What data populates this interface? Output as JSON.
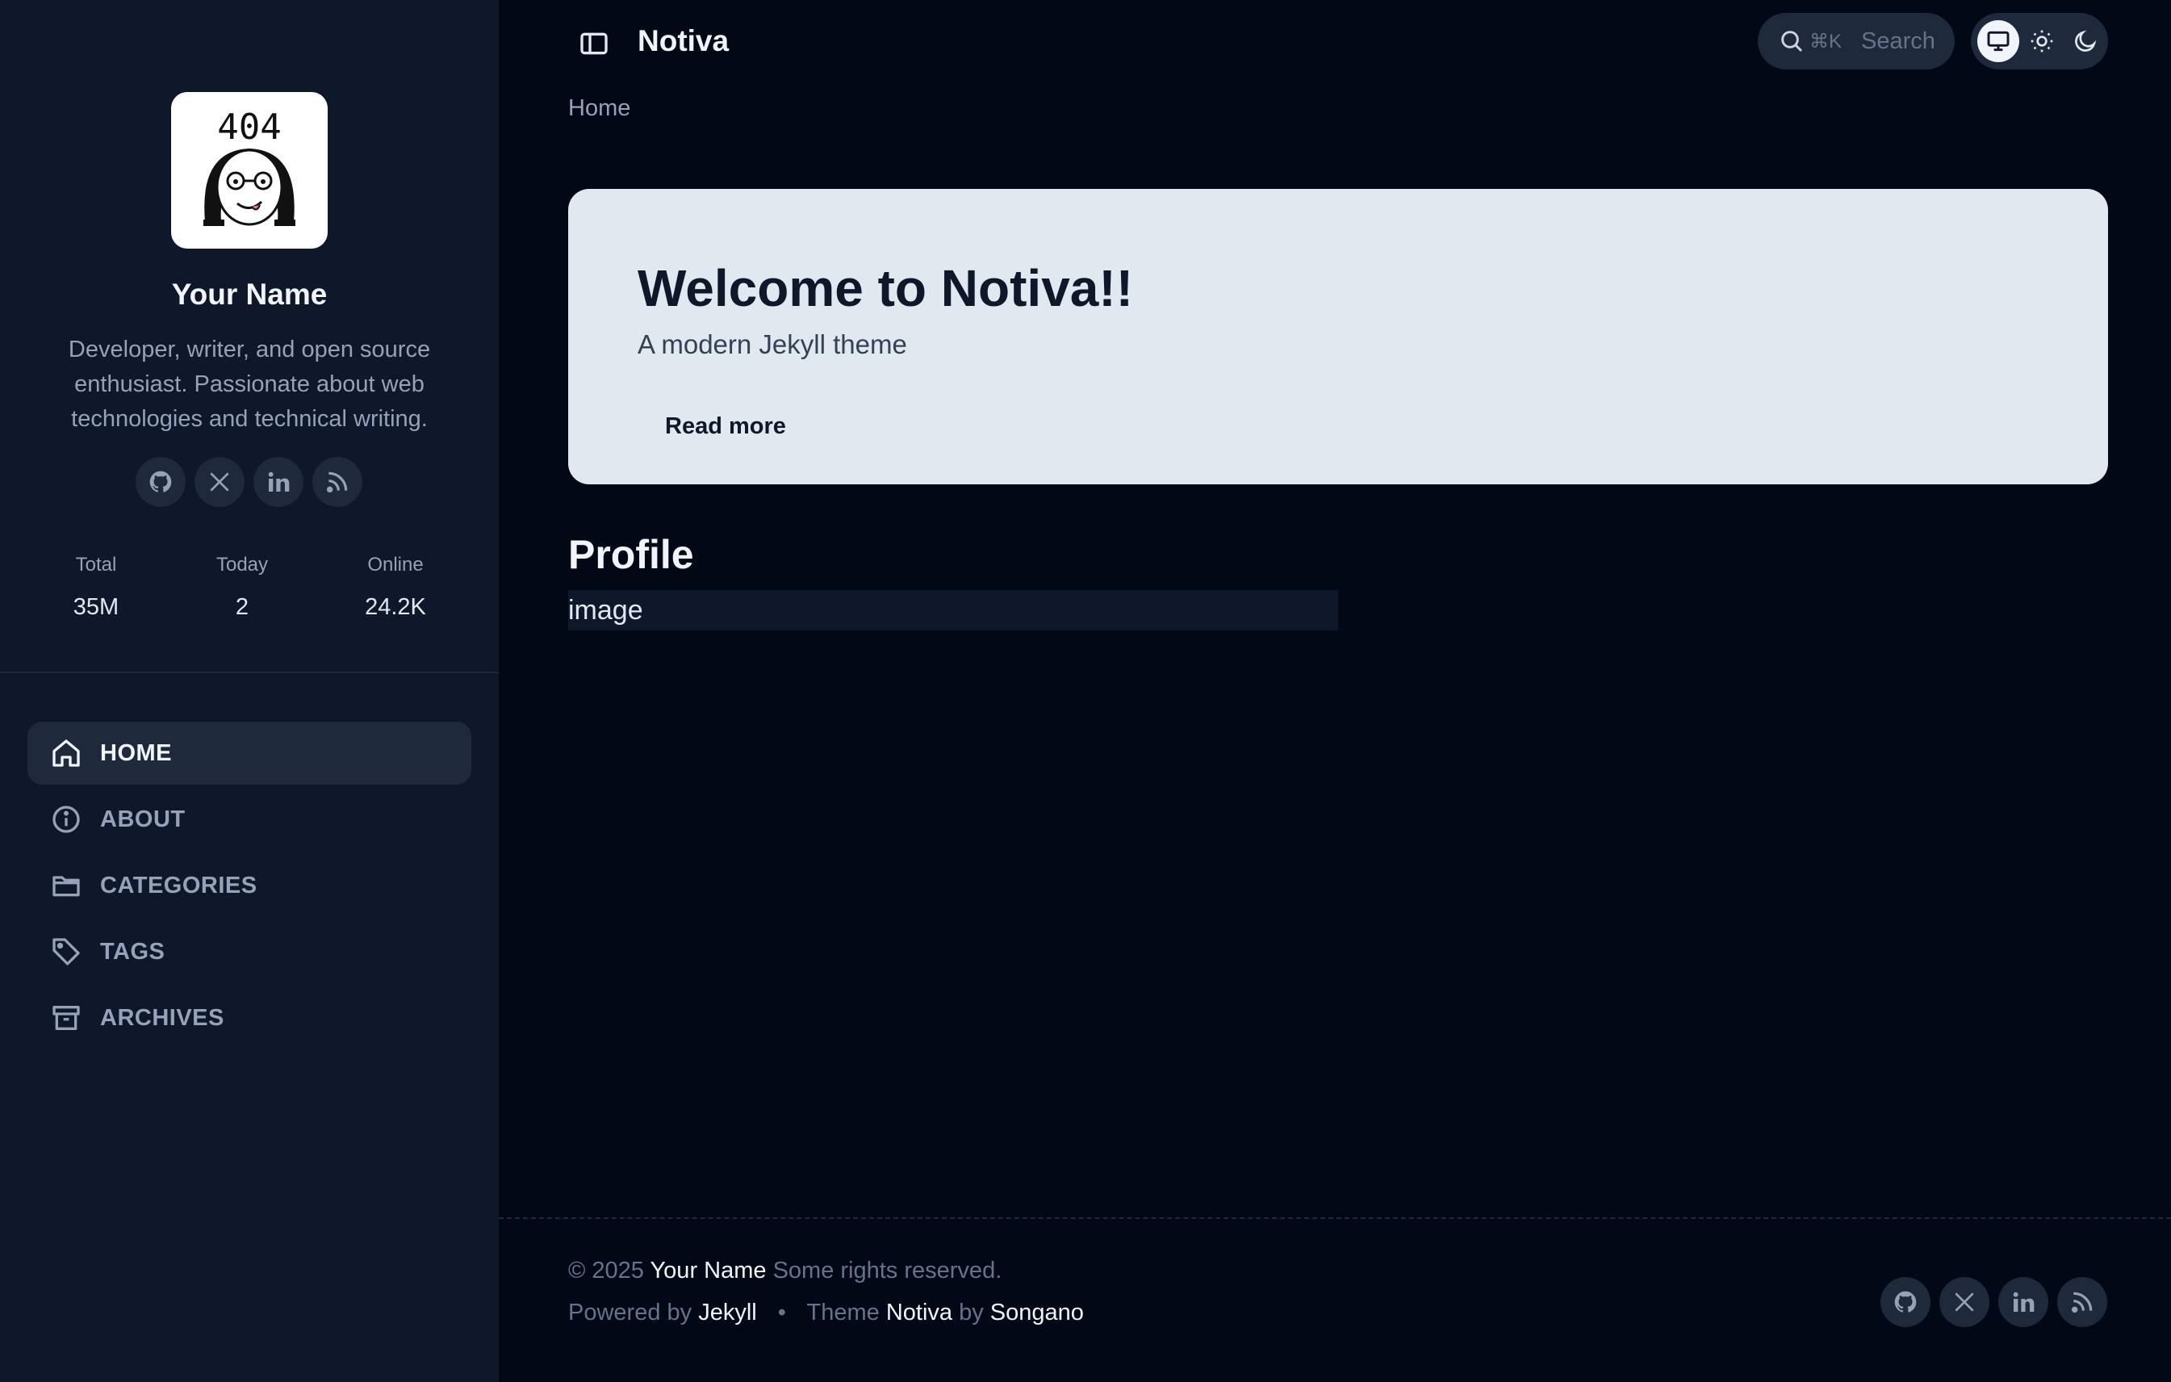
{
  "sidebar": {
    "avatar_text": "404",
    "name": "Your Name",
    "bio": "Developer, writer, and open source enthusiast. Passionate about web technologies and technical writing.",
    "social": [
      {
        "icon": "github-icon"
      },
      {
        "icon": "x-icon"
      },
      {
        "icon": "linkedin-icon"
      },
      {
        "icon": "rss-icon"
      }
    ],
    "stats": [
      {
        "label": "Total",
        "value": "35M"
      },
      {
        "label": "Today",
        "value": "2"
      },
      {
        "label": "Online",
        "value": "24.2K"
      }
    ],
    "nav": [
      {
        "label": "HOME",
        "icon": "home-icon",
        "active": true
      },
      {
        "label": "ABOUT",
        "icon": "info-icon",
        "active": false
      },
      {
        "label": "CATEGORIES",
        "icon": "folder-icon",
        "active": false
      },
      {
        "label": "TAGS",
        "icon": "tag-icon",
        "active": false
      },
      {
        "label": "ARCHIVES",
        "icon": "archive-icon",
        "active": false
      }
    ]
  },
  "topbar": {
    "site_title": "Notiva",
    "search_shortcut": "⌘K",
    "search_placeholder": "Search",
    "theme_options": [
      "system",
      "light",
      "dark"
    ],
    "theme_selected": "system"
  },
  "breadcrumb": "Home",
  "hero": {
    "title": "Welcome to Notiva!!",
    "subtitle": "A modern Jekyll theme",
    "button": "Read more"
  },
  "content": {
    "section_title": "Profile",
    "image_alt": "image"
  },
  "footer": {
    "copyright_prefix": "© 2025",
    "owner": "Your Name",
    "rights": "Some rights reserved.",
    "powered_by": "Powered by",
    "engine": "Jekyll",
    "separator": "•",
    "theme_label": "Theme",
    "theme_name": "Notiva",
    "by": "by",
    "author": "Songano"
  },
  "colors": {
    "background": "#030817",
    "sidebar": "#0f172a",
    "hero": "#e2e8f0",
    "text": "#e2e8f0",
    "muted": "#94a3b8"
  }
}
